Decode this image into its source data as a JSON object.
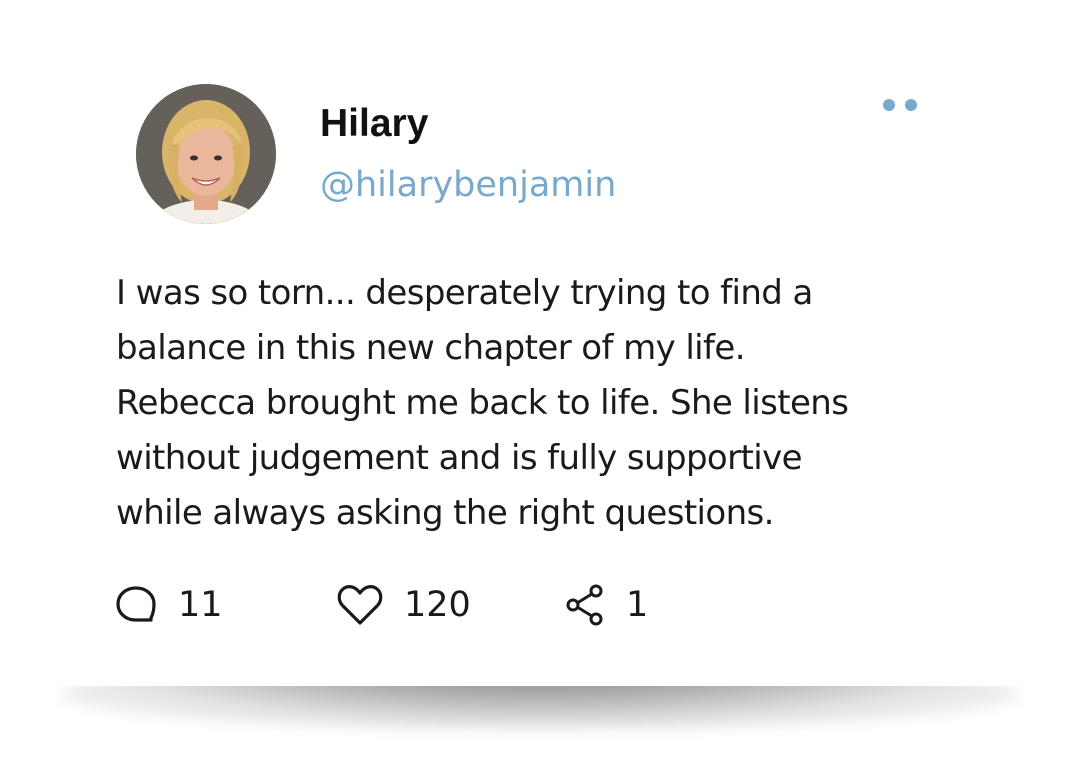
{
  "post": {
    "author": {
      "name": "Hilary",
      "handle": "@hilarybenjamin",
      "avatar_icon": "profile-photo"
    },
    "text_lines": [
      "I was so torn... desperately trying to find a",
      "balance in this new chapter of my life.",
      "Rebecca brought me back to life. She listens",
      "without judgement and is fully supportive",
      "while always asking the right questions."
    ],
    "stats": {
      "comments": "11",
      "likes": "120",
      "shares": "1"
    },
    "icons": {
      "comment": "comment-bubble-icon",
      "like": "heart-icon",
      "share": "share-icon",
      "more": "more-options-icon"
    },
    "colors": {
      "accent": "#78a8cc",
      "text": "#1a1a1a",
      "name": "#111111"
    }
  }
}
